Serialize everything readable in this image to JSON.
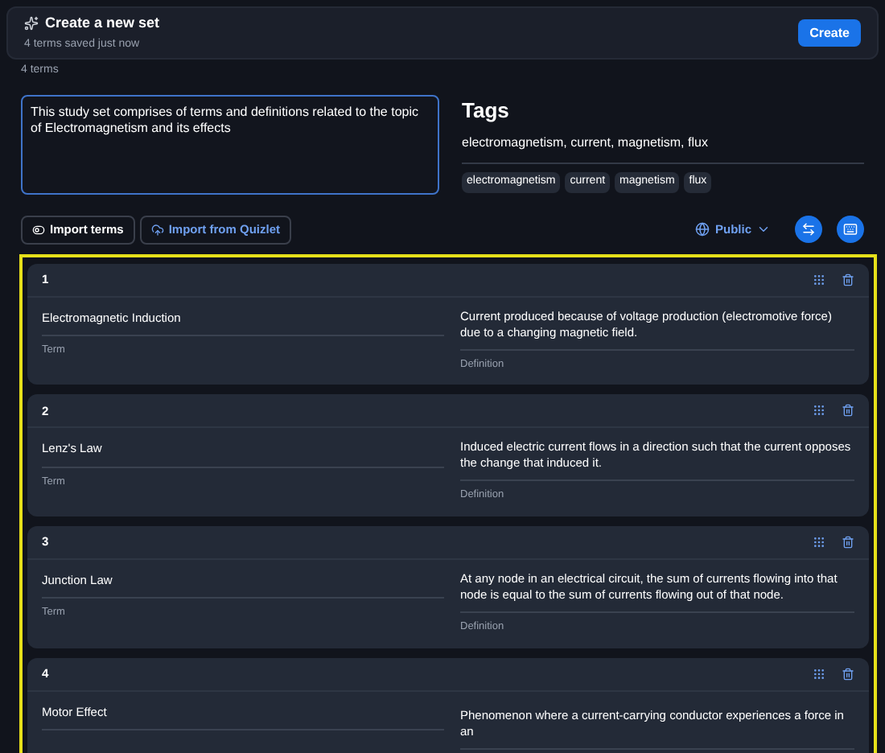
{
  "header": {
    "title": "Create a new set",
    "status": "4 terms saved just now",
    "create_button": "Create"
  },
  "term_count": "4 terms",
  "description": {
    "value": "This study set comprises of terms and definitions related to the topic of Electromagnetism and its effects"
  },
  "tags": {
    "heading": "Tags",
    "value": "electromagnetism, current, magnetism, flux",
    "chips": [
      "electromagnetism",
      "current",
      "magnetism",
      "flux"
    ]
  },
  "toolbar": {
    "import_terms": "Import terms",
    "import_quizlet": "Import from Quizlet",
    "visibility": "Public"
  },
  "cards": [
    {
      "number": "1",
      "term": "Electromagnetic Induction",
      "term_label": "Term",
      "definition": "Current produced because of voltage production (electromotive force) due to a changing magnetic field.",
      "definition_label": "Definition"
    },
    {
      "number": "2",
      "term": "Lenz's Law",
      "term_label": "Term",
      "definition": "Induced electric current flows in a direction such that the current opposes the change that induced it.",
      "definition_label": "Definition"
    },
    {
      "number": "3",
      "term": "Junction Law",
      "term_label": "Term",
      "definition": "At any node in an electrical circuit, the sum of currents flowing into that node is equal to the sum of currents flowing out of that node.",
      "definition_label": "Definition"
    },
    {
      "number": "4",
      "term": "Motor Effect",
      "definition": "Phenomenon where a current-carrying conductor experiences a force in an"
    }
  ]
}
